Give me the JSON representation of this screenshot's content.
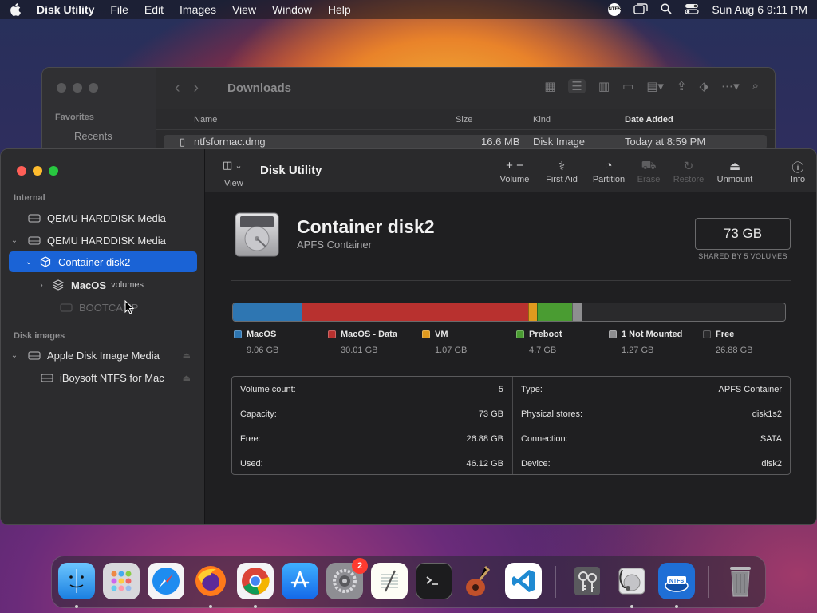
{
  "menubar": {
    "app": "Disk Utility",
    "items": [
      "File",
      "Edit",
      "Images",
      "View",
      "Window",
      "Help"
    ],
    "ntfs": "NTFS",
    "clock": "Sun Aug 6  9:11 PM"
  },
  "finder": {
    "title": "Downloads",
    "sidebar_section": "Favorites",
    "sidebar_item": "Recents",
    "columns": [
      "Name",
      "Size",
      "Kind",
      "Date Added"
    ],
    "file": {
      "name": "ntfsformac.dmg",
      "size": "16.6 MB",
      "kind": "Disk Image",
      "date": "Today at 8:59 PM"
    }
  },
  "du": {
    "title": "Disk Utility",
    "view_label": "View",
    "toolbar": [
      {
        "label": "Volume",
        "icon": "plus-minus-icon",
        "glyph": "+  −",
        "enabled": true
      },
      {
        "label": "First Aid",
        "icon": "stethoscope-icon",
        "glyph": "⚕",
        "enabled": true
      },
      {
        "label": "Partition",
        "icon": "pie-icon",
        "glyph": "◔",
        "enabled": true
      },
      {
        "label": "Erase",
        "icon": "erase-icon",
        "glyph": "⛟",
        "enabled": false
      },
      {
        "label": "Restore",
        "icon": "restore-icon",
        "glyph": "↻",
        "enabled": false
      },
      {
        "label": "Unmount",
        "icon": "eject-icon",
        "glyph": "⏏",
        "enabled": true
      },
      {
        "label": "Info",
        "icon": "info-icon",
        "glyph": "ⓘ",
        "enabled": true
      }
    ],
    "sidebar": {
      "section_internal": "Internal",
      "section_images": "Disk images",
      "items": [
        {
          "label": "QEMU HARDDISK Media"
        },
        {
          "label": "QEMU HARDDISK Media"
        },
        {
          "label": "Container disk2"
        },
        {
          "label": "MacOS",
          "sub": "volumes"
        },
        {
          "label": "BOOTCAMP"
        },
        {
          "label": "Apple Disk Image Media"
        },
        {
          "label": "iBoysoft NTFS for Mac"
        }
      ]
    },
    "disk": {
      "name": "Container disk2",
      "type": "APFS Container",
      "capacity": "73 GB",
      "shared": "SHARED BY 5 VOLUMES"
    },
    "usage": [
      {
        "name": "MacOS",
        "value": "9.06 GB",
        "gb": 9.06,
        "color": "#2e76b2"
      },
      {
        "name": "MacOS - Data",
        "value": "30.01 GB",
        "gb": 30.01,
        "color": "#b8312f"
      },
      {
        "name": "VM",
        "value": "1.07 GB",
        "gb": 1.07,
        "color": "#e09a1e"
      },
      {
        "name": "Preboot",
        "value": "4.7 GB",
        "gb": 4.7,
        "color": "#4a9c32"
      },
      {
        "name": "1 Not Mounted",
        "value": "1.27 GB",
        "gb": 1.27,
        "color": "#8e8e90"
      },
      {
        "name": "Free",
        "value": "26.88 GB",
        "gb": 26.88,
        "color": "#2a2a2c"
      }
    ],
    "info_left": [
      {
        "label": "Volume count:",
        "value": "5"
      },
      {
        "label": "Capacity:",
        "value": "73 GB"
      },
      {
        "label": "Free:",
        "value": "26.88 GB"
      },
      {
        "label": "Used:",
        "value": "46.12 GB"
      }
    ],
    "info_right": [
      {
        "label": "Type:",
        "value": "APFS Container"
      },
      {
        "label": "Physical stores:",
        "value": "disk1s2"
      },
      {
        "label": "Connection:",
        "value": "SATA"
      },
      {
        "label": "Device:",
        "value": "disk2"
      }
    ]
  },
  "dock": {
    "badge_settings": "2",
    "ntfs_label": "NTFS"
  }
}
